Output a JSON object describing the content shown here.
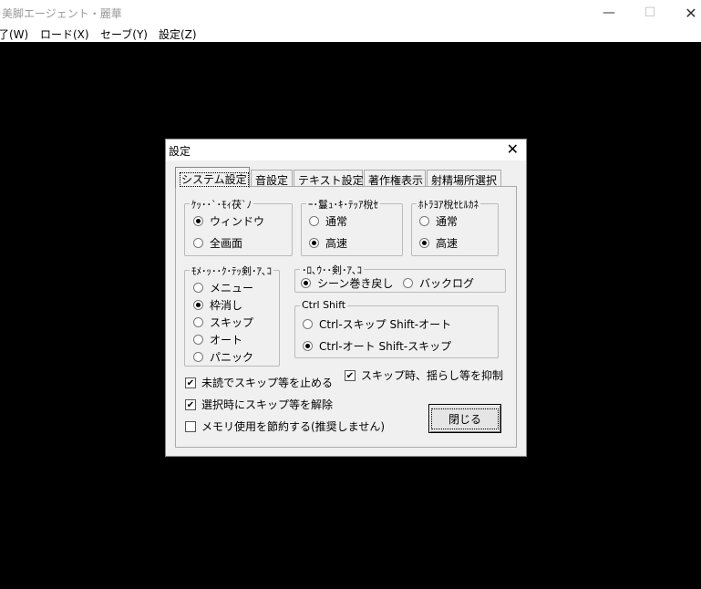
{
  "window": {
    "title": "美脚エージェント・麗華",
    "minimize_glyph": "—",
    "maximize_glyph": "☐",
    "close_glyph": "✕"
  },
  "menu": {
    "items": [
      "了(W)",
      "ロード(X)",
      "セーブ(Y)",
      "設定(Z)"
    ]
  },
  "dialog": {
    "title": "設定",
    "close_glyph": "✕",
    "tabs": [
      "システム設定",
      "音設定",
      "テキスト設定",
      "著作権表示",
      "射精場所選択"
    ],
    "active_tab": 0,
    "groups": {
      "display": {
        "label": "ｹｯ･･`･ﾓｨ茯`ﾉ",
        "options": [
          "ウィンドウ",
          "全画面"
        ],
        "selected": 0
      },
      "speed1": {
        "label": "ｰ･鬘ｭ･ｷ･ﾃｯｱ梲ｾ",
        "options": [
          "通常",
          "高速"
        ],
        "selected": 1
      },
      "speed2": {
        "label": "ﾎﾄﾗﾖｱ梲ｾﾋﾙｶﾈ",
        "options": [
          "通常",
          "高速"
        ],
        "selected": 1
      },
      "rightclick": {
        "label": "ﾓﾒ･ｯ･･ｸ･ﾃｯ剣･ｱ､ｺ",
        "options": [
          "メニュー",
          "枠消し",
          "スキップ",
          "オート",
          "パニック"
        ],
        "selected": 1
      },
      "wheel": {
        "label": "･ﾛ､ｳ･･剣･ｱ､ｺ",
        "options": [
          "シーン巻き戻し",
          "バックログ"
        ],
        "selected": 0
      },
      "ctrlshift": {
        "label": "Ctrl Shift",
        "options": [
          "Ctrl-スキップ Shift-オート",
          "Ctrl-オート Shift-スキップ"
        ],
        "selected": 1
      }
    },
    "checks": {
      "stop_unread": {
        "label": "未読でスキップ等を止める",
        "checked": "✔"
      },
      "suppress_shake": {
        "label": "スキップ時、揺らし等を抑制",
        "checked": "✔"
      },
      "cancel_on_choice": {
        "label": "選択時にスキップ等を解除",
        "checked": "✔"
      },
      "save_memory": {
        "label": "メモリ使用を節約する(推奨しません)",
        "checked": ""
      }
    },
    "close_button": "閉じる"
  }
}
